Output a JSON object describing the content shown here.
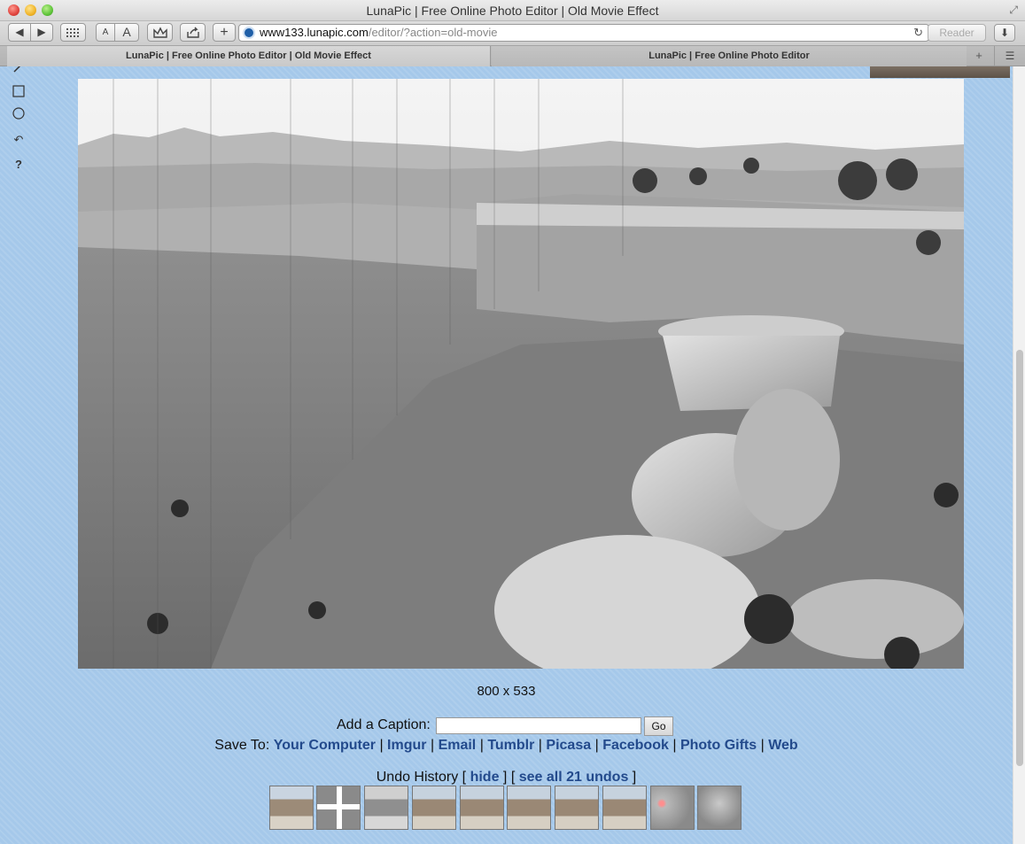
{
  "window": {
    "title": "LunaPic | Free Online Photo Editor | Old Movie Effect"
  },
  "toolbar": {
    "back_label": "◀",
    "forward_label": "▶",
    "font_small_label": "A",
    "font_large_label": "A",
    "add_label": "+",
    "url_host": "www133.lunapic.com",
    "url_path": "/editor/?action=old-movie",
    "reader_label": "Reader"
  },
  "tabs": [
    {
      "label": "LunaPic | Free Online Photo Editor | Old Movie Effect",
      "active": true
    },
    {
      "label": "LunaPic | Free Online Photo Editor",
      "active": false
    }
  ],
  "tools": [
    "pencil-icon",
    "select-rect-icon",
    "select-circle-icon",
    "undo-icon",
    "help-icon"
  ],
  "image": {
    "dimensions_text": "800 x 533",
    "effect": "old-movie grayscale canyon photo"
  },
  "caption": {
    "label": "Add a Caption:",
    "value": "",
    "go_label": "Go"
  },
  "save": {
    "prefix": "Save To:",
    "links": [
      "Your Computer",
      "Imgur",
      "Email",
      "Tumblr",
      "Picasa",
      "Facebook",
      "Photo Gifts",
      "Web"
    ]
  },
  "undo": {
    "label": "Undo History",
    "open_bracket": "[",
    "close_bracket": "]",
    "hide_label": "hide",
    "see_all_label": "see all 21 undos"
  },
  "colors": {
    "page_background": "#a5c8ea",
    "link": "#234a8c"
  }
}
